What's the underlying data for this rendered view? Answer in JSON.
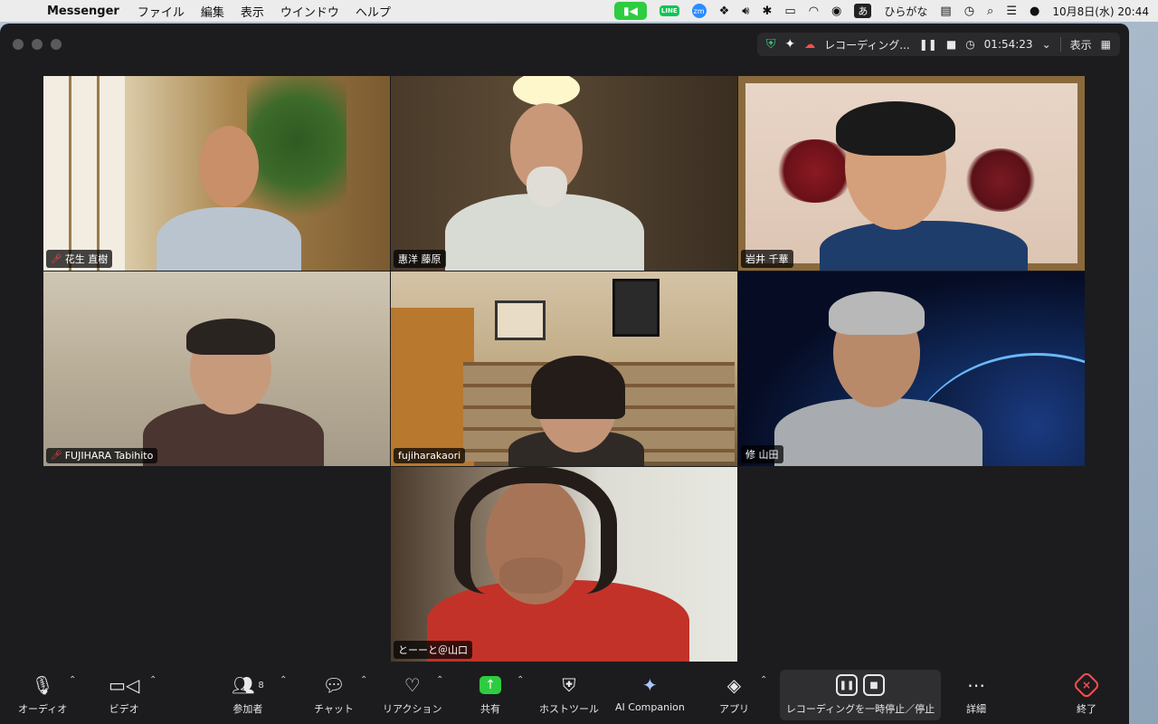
{
  "menubar": {
    "app_name": "Messenger",
    "menus": [
      "ファイル",
      "編集",
      "表示",
      "ウインドウ",
      "ヘルプ"
    ],
    "line_label": "LINE",
    "zm_label": "zm",
    "ime_char": "あ",
    "ime_label": "ひらがな",
    "clock": "10月8日(水)  20:44"
  },
  "topbar": {
    "recording_label": "レコーディング...",
    "timer": "01:54:23",
    "view_label": "表示"
  },
  "participants": [
    {
      "name": "花生 直樹",
      "muted": true
    },
    {
      "name": "惠洋 藤原",
      "muted": false
    },
    {
      "name": "岩井 千華",
      "muted": false,
      "active_speaker": true
    },
    {
      "name": "FUJIHARA Tabihito",
      "muted": true
    },
    {
      "name": "fujiharakaori",
      "muted": false
    },
    {
      "name": "修 山田",
      "muted": false
    },
    {
      "name": "とーーと＠山口",
      "muted": false
    }
  ],
  "toolbar": {
    "audio": "オーディオ",
    "video": "ビデオ",
    "participants": "参加者",
    "participant_count": "8",
    "chat": "チャット",
    "reactions": "リアクション",
    "share": "共有",
    "host_tools": "ホストツール",
    "ai_companion": "AI Companion",
    "apps": "アプリ",
    "recording": "レコーディングを一時停止／停止",
    "more": "詳細",
    "end": "終了"
  }
}
